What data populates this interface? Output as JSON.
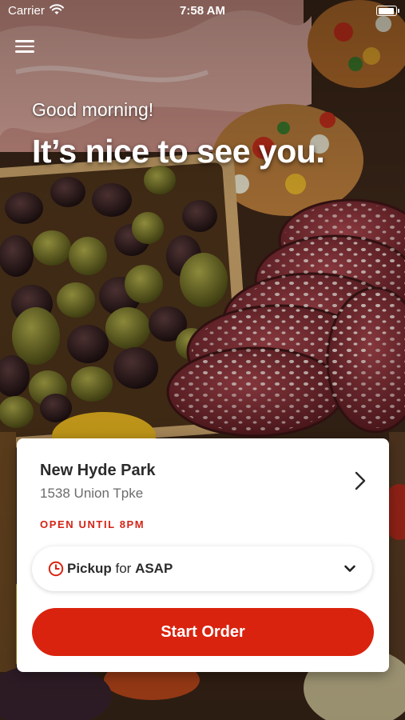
{
  "status_bar": {
    "carrier": "Carrier",
    "time": "7:58 AM"
  },
  "greeting": {
    "line1": "Good morning!",
    "line2": "It’s nice to see you."
  },
  "location": {
    "name": "New Hyde Park",
    "address": "1538 Union Tpke",
    "hours": "OPEN UNTIL 8PM"
  },
  "order_mode": {
    "method": "Pickup",
    "connector": "for",
    "time": "ASAP"
  },
  "actions": {
    "start_order": "Start Order"
  },
  "colors": {
    "accent": "#d9230f",
    "open_text": "#d42416"
  },
  "icons": {
    "menu": "hamburger-menu-icon",
    "chevron": "chevron-right-icon",
    "clock": "clock-icon",
    "dropdown": "chevron-down-icon",
    "wifi": "wifi-icon",
    "battery": "battery-icon"
  }
}
